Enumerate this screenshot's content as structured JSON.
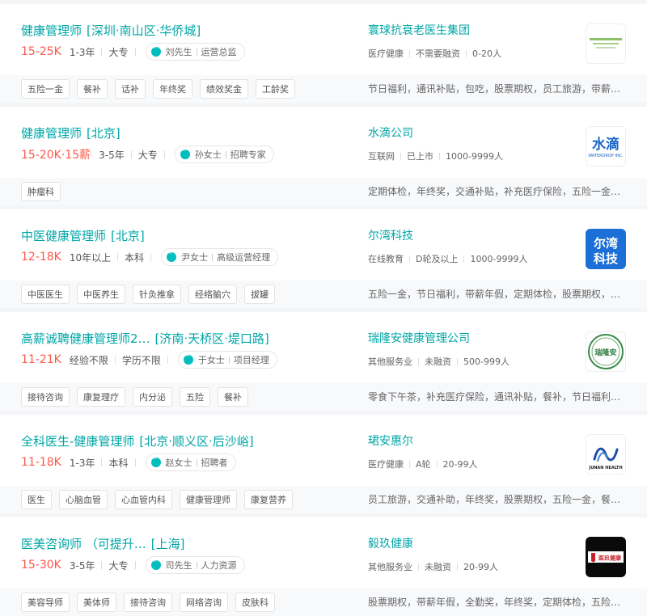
{
  "jobs": [
    {
      "title": "健康管理师",
      "location": "[深圳·南山区·华侨城]",
      "salary": "15-25K",
      "experience": "1-3年",
      "education": "大专",
      "recruiter_name": "刘先生",
      "recruiter_title": "运营总监",
      "company": "寰球抗衰老医生集团",
      "industry": "医疗健康",
      "stage": "不需要融资",
      "size": "0-20人",
      "tags": [
        "五险一金",
        "餐补",
        "话补",
        "年终奖",
        "绩效奖金",
        "工龄奖"
      ],
      "benefits": "节日福利，通讯补贴，包吃，股票期权，员工旅游，带薪…",
      "logo_icon": "green-text-logo-icon"
    },
    {
      "title": "健康管理师",
      "location": "[北京]",
      "salary": "15-20K·15薪",
      "experience": "3-5年",
      "education": "大专",
      "recruiter_name": "孙女士",
      "recruiter_title": "招聘专家",
      "company": "水滴公司",
      "industry": "互联网",
      "stage": "已上市",
      "size": "1000-9999人",
      "tags": [
        "肿瘤科"
      ],
      "benefits": "定期体检，年终奖，交通补贴，补充医疗保险，五险一金…",
      "logo_icon": "waterdrop-logo-icon",
      "logo_text_main": "水滴",
      "logo_text_sub": "WATERDROP INC."
    },
    {
      "title": "中医健康管理师",
      "location": "[北京]",
      "salary": "12-18K",
      "experience": "10年以上",
      "education": "本科",
      "recruiter_name": "尹女士",
      "recruiter_title": "高级运营经理",
      "company": "尔湾科技",
      "industry": "在线教育",
      "stage": "D轮及以上",
      "size": "1000-9999人",
      "tags": [
        "中医医生",
        "中医养生",
        "针灸推拿",
        "经络腧穴",
        "拔罐"
      ],
      "benefits": "五险一金，节日福利，带薪年假，定期体检，股票期权，…",
      "logo_icon": "erwan-logo-icon",
      "logo_text_main": "尔湾",
      "logo_text_sub": "科技"
    },
    {
      "title": "高薪诚聘健康管理师2…",
      "location": "[济南·天桥区·堤口路]",
      "salary": "11-21K",
      "experience": "经验不限",
      "education": "学历不限",
      "recruiter_name": "于女士",
      "recruiter_title": "项目经理",
      "company": "瑞隆安健康管理公司",
      "industry": "其他服务业",
      "stage": "未融资",
      "size": "500-999人",
      "tags": [
        "接待咨询",
        "康复理疗",
        "内分泌",
        "五险",
        "餐补"
      ],
      "benefits": "零食下午茶，补充医疗保险，通讯补贴，餐补，节日福利…",
      "logo_icon": "ruilongan-seal-icon",
      "logo_text_main": "瑞隆安"
    },
    {
      "title": "全科医生-健康管理师",
      "location": "[北京·顺义区·后沙峪]",
      "salary": "11-18K",
      "experience": "1-3年",
      "education": "本科",
      "recruiter_name": "赵女士",
      "recruiter_title": "招聘者",
      "company": "珺安惠尔",
      "industry": "医疗健康",
      "stage": "A轮",
      "size": "20-99人",
      "tags": [
        "医生",
        "心脑血管",
        "心血管内科",
        "健康管理师",
        "康复营养"
      ],
      "benefits": "员工旅游，交通补助，年终奖，股票期权，五险一金，餐…",
      "logo_icon": "junan-health-logo-icon",
      "logo_text_main": "JUNAN HEALTH"
    },
    {
      "title": "医美咨询师 （可提升…",
      "location": "[上海]",
      "salary": "15-30K",
      "experience": "3-5年",
      "education": "大专",
      "recruiter_name": "司先生",
      "recruiter_title": "人力资源",
      "company": "毅玖健康",
      "industry": "其他服务业",
      "stage": "未融资",
      "size": "20-99人",
      "tags": [
        "美容导师",
        "美体师",
        "接待咨询",
        "网络咨询",
        "皮肤科"
      ],
      "benefits": "股票期权，带薪年假，全勤奖，年终奖，定期体检，五险…",
      "logo_icon": "yijiu-health-logo-icon",
      "logo_text_main": "医玖健康"
    }
  ]
}
